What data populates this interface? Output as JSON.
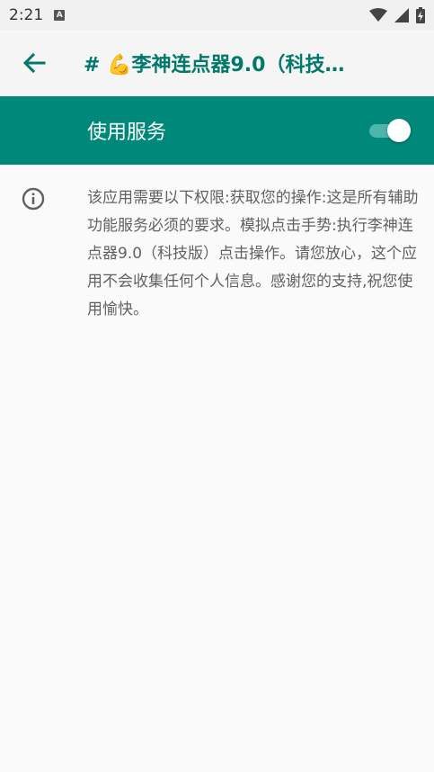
{
  "status_bar": {
    "time": "2:21",
    "notification_icon_letter": "A",
    "icons": [
      "wifi-icon",
      "signal-icon",
      "battery-icon"
    ]
  },
  "app_bar": {
    "back_icon": "arrow-left-icon",
    "title": "# 💪李神连点器9.0（科技…"
  },
  "service": {
    "label": "使用服务",
    "enabled": true
  },
  "info": {
    "icon": "info-icon",
    "description": "该应用需要以下权限:获取您的操作:这是所有辅助功能服务必须的要求。模拟点击手势:执行李神连点器9.0（科技版）点击操作。请您放心，这个应用不会收集任何个人信息。感谢您的支持,祝您使用愉快。"
  },
  "colors": {
    "accent": "#00897B",
    "title_color": "#00796B",
    "toggle_track": "#4DB6AC",
    "background": "#FAFAFA"
  }
}
